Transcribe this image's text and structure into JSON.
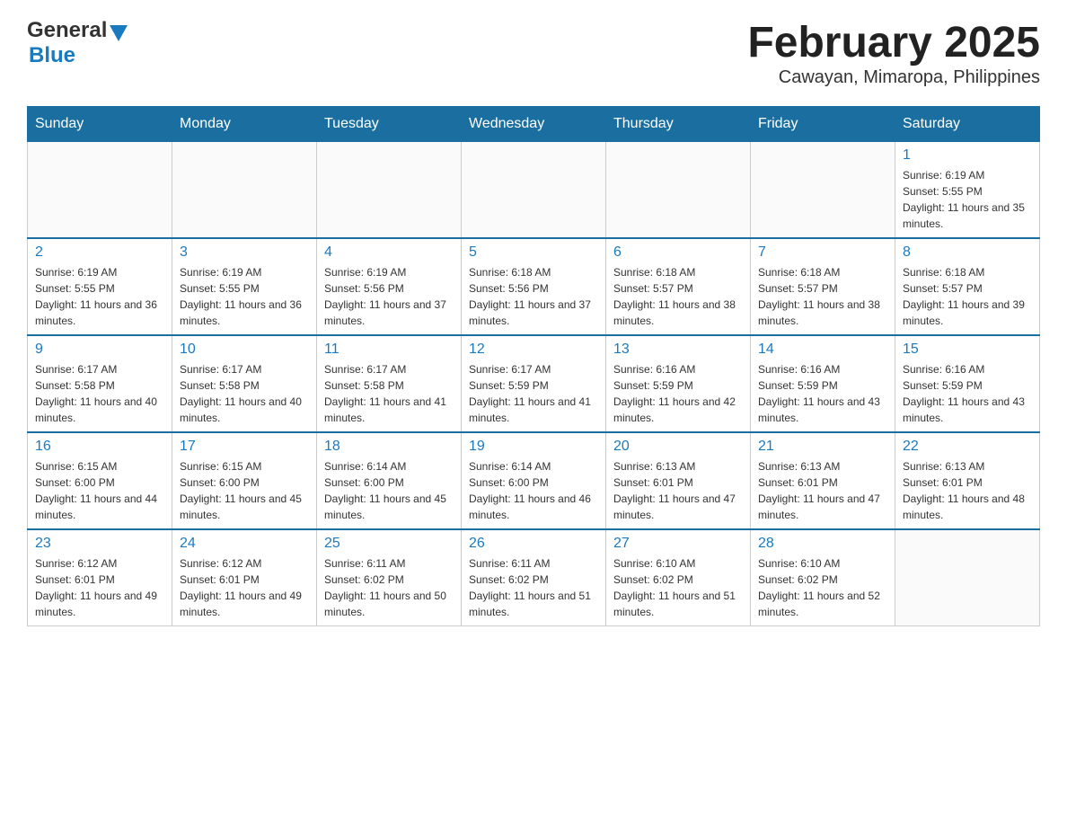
{
  "logo": {
    "general": "General",
    "blue": "Blue"
  },
  "header": {
    "month_title": "February 2025",
    "location": "Cawayan, Mimaropa, Philippines"
  },
  "days_of_week": [
    "Sunday",
    "Monday",
    "Tuesday",
    "Wednesday",
    "Thursday",
    "Friday",
    "Saturday"
  ],
  "weeks": [
    {
      "days": [
        {
          "num": "",
          "info": ""
        },
        {
          "num": "",
          "info": ""
        },
        {
          "num": "",
          "info": ""
        },
        {
          "num": "",
          "info": ""
        },
        {
          "num": "",
          "info": ""
        },
        {
          "num": "",
          "info": ""
        },
        {
          "num": "1",
          "info": "Sunrise: 6:19 AM\nSunset: 5:55 PM\nDaylight: 11 hours and 35 minutes."
        }
      ]
    },
    {
      "days": [
        {
          "num": "2",
          "info": "Sunrise: 6:19 AM\nSunset: 5:55 PM\nDaylight: 11 hours and 36 minutes."
        },
        {
          "num": "3",
          "info": "Sunrise: 6:19 AM\nSunset: 5:55 PM\nDaylight: 11 hours and 36 minutes."
        },
        {
          "num": "4",
          "info": "Sunrise: 6:19 AM\nSunset: 5:56 PM\nDaylight: 11 hours and 37 minutes."
        },
        {
          "num": "5",
          "info": "Sunrise: 6:18 AM\nSunset: 5:56 PM\nDaylight: 11 hours and 37 minutes."
        },
        {
          "num": "6",
          "info": "Sunrise: 6:18 AM\nSunset: 5:57 PM\nDaylight: 11 hours and 38 minutes."
        },
        {
          "num": "7",
          "info": "Sunrise: 6:18 AM\nSunset: 5:57 PM\nDaylight: 11 hours and 38 minutes."
        },
        {
          "num": "8",
          "info": "Sunrise: 6:18 AM\nSunset: 5:57 PM\nDaylight: 11 hours and 39 minutes."
        }
      ]
    },
    {
      "days": [
        {
          "num": "9",
          "info": "Sunrise: 6:17 AM\nSunset: 5:58 PM\nDaylight: 11 hours and 40 minutes."
        },
        {
          "num": "10",
          "info": "Sunrise: 6:17 AM\nSunset: 5:58 PM\nDaylight: 11 hours and 40 minutes."
        },
        {
          "num": "11",
          "info": "Sunrise: 6:17 AM\nSunset: 5:58 PM\nDaylight: 11 hours and 41 minutes."
        },
        {
          "num": "12",
          "info": "Sunrise: 6:17 AM\nSunset: 5:59 PM\nDaylight: 11 hours and 41 minutes."
        },
        {
          "num": "13",
          "info": "Sunrise: 6:16 AM\nSunset: 5:59 PM\nDaylight: 11 hours and 42 minutes."
        },
        {
          "num": "14",
          "info": "Sunrise: 6:16 AM\nSunset: 5:59 PM\nDaylight: 11 hours and 43 minutes."
        },
        {
          "num": "15",
          "info": "Sunrise: 6:16 AM\nSunset: 5:59 PM\nDaylight: 11 hours and 43 minutes."
        }
      ]
    },
    {
      "days": [
        {
          "num": "16",
          "info": "Sunrise: 6:15 AM\nSunset: 6:00 PM\nDaylight: 11 hours and 44 minutes."
        },
        {
          "num": "17",
          "info": "Sunrise: 6:15 AM\nSunset: 6:00 PM\nDaylight: 11 hours and 45 minutes."
        },
        {
          "num": "18",
          "info": "Sunrise: 6:14 AM\nSunset: 6:00 PM\nDaylight: 11 hours and 45 minutes."
        },
        {
          "num": "19",
          "info": "Sunrise: 6:14 AM\nSunset: 6:00 PM\nDaylight: 11 hours and 46 minutes."
        },
        {
          "num": "20",
          "info": "Sunrise: 6:13 AM\nSunset: 6:01 PM\nDaylight: 11 hours and 47 minutes."
        },
        {
          "num": "21",
          "info": "Sunrise: 6:13 AM\nSunset: 6:01 PM\nDaylight: 11 hours and 47 minutes."
        },
        {
          "num": "22",
          "info": "Sunrise: 6:13 AM\nSunset: 6:01 PM\nDaylight: 11 hours and 48 minutes."
        }
      ]
    },
    {
      "days": [
        {
          "num": "23",
          "info": "Sunrise: 6:12 AM\nSunset: 6:01 PM\nDaylight: 11 hours and 49 minutes."
        },
        {
          "num": "24",
          "info": "Sunrise: 6:12 AM\nSunset: 6:01 PM\nDaylight: 11 hours and 49 minutes."
        },
        {
          "num": "25",
          "info": "Sunrise: 6:11 AM\nSunset: 6:02 PM\nDaylight: 11 hours and 50 minutes."
        },
        {
          "num": "26",
          "info": "Sunrise: 6:11 AM\nSunset: 6:02 PM\nDaylight: 11 hours and 51 minutes."
        },
        {
          "num": "27",
          "info": "Sunrise: 6:10 AM\nSunset: 6:02 PM\nDaylight: 11 hours and 51 minutes."
        },
        {
          "num": "28",
          "info": "Sunrise: 6:10 AM\nSunset: 6:02 PM\nDaylight: 11 hours and 52 minutes."
        },
        {
          "num": "",
          "info": ""
        }
      ]
    }
  ]
}
